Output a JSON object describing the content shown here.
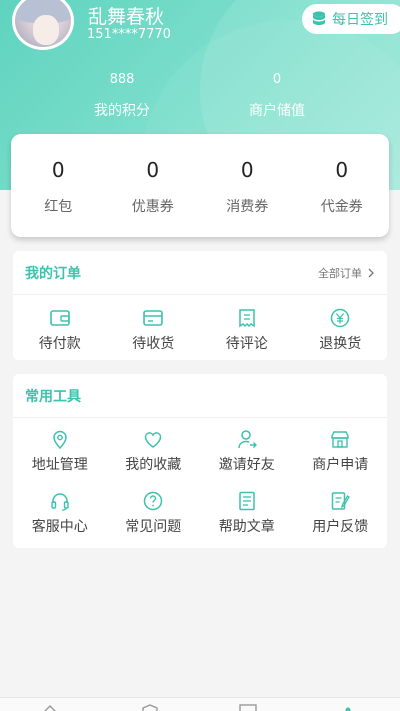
{
  "colors": {
    "accent": "#3cc2ad",
    "header_start": "#5fd3bf",
    "header_end": "#9ee8d8"
  },
  "profile": {
    "name": "乱舞春秋",
    "phone": "151****7770"
  },
  "signin": {
    "label": "每日签到",
    "icon": "database-icon"
  },
  "stats": [
    {
      "value": "888",
      "label": "我的积分"
    },
    {
      "value": "0",
      "label": "商户储值"
    }
  ],
  "wallet": [
    {
      "value": "0",
      "label": "红包"
    },
    {
      "value": "0",
      "label": "优惠券"
    },
    {
      "value": "0",
      "label": "消费券"
    },
    {
      "value": "0",
      "label": "代金券"
    }
  ],
  "orders": {
    "title": "我的订单",
    "more": "全部订单",
    "items": [
      {
        "label": "待付款",
        "icon": "wallet-icon"
      },
      {
        "label": "待收货",
        "icon": "card-icon"
      },
      {
        "label": "待评论",
        "icon": "receipt-icon"
      },
      {
        "label": "退换货",
        "icon": "yen-icon"
      }
    ]
  },
  "tools": {
    "title": "常用工具",
    "items": [
      {
        "label": "地址管理",
        "icon": "location-icon"
      },
      {
        "label": "我的收藏",
        "icon": "heart-icon"
      },
      {
        "label": "邀请好友",
        "icon": "user-invite-icon"
      },
      {
        "label": "商户申请",
        "icon": "shop-icon"
      },
      {
        "label": "客服中心",
        "icon": "headset-icon"
      },
      {
        "label": "常见问题",
        "icon": "question-icon"
      },
      {
        "label": "帮助文章",
        "icon": "document-icon"
      },
      {
        "label": "用户反馈",
        "icon": "feedback-icon"
      }
    ]
  }
}
